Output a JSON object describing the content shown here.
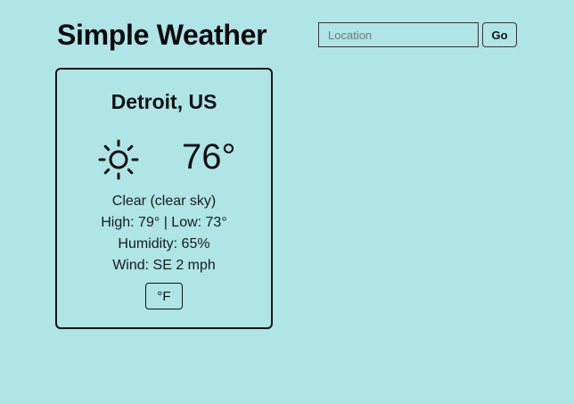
{
  "app": {
    "title": "Simple Weather"
  },
  "search": {
    "placeholder": "Location",
    "value": "",
    "button_label": "Go"
  },
  "weather": {
    "city": "Detroit, US",
    "icon": "sun-icon",
    "temperature": "76°",
    "description": "Clear (clear sky)",
    "high_low": "High: 79° | Low: 73°",
    "humidity": "Humidity: 65%",
    "wind": "Wind: SE 2 mph",
    "unit_toggle_label": "°F"
  },
  "colors": {
    "background": "#afe5e7",
    "text": "#111111",
    "border": "#111111"
  }
}
